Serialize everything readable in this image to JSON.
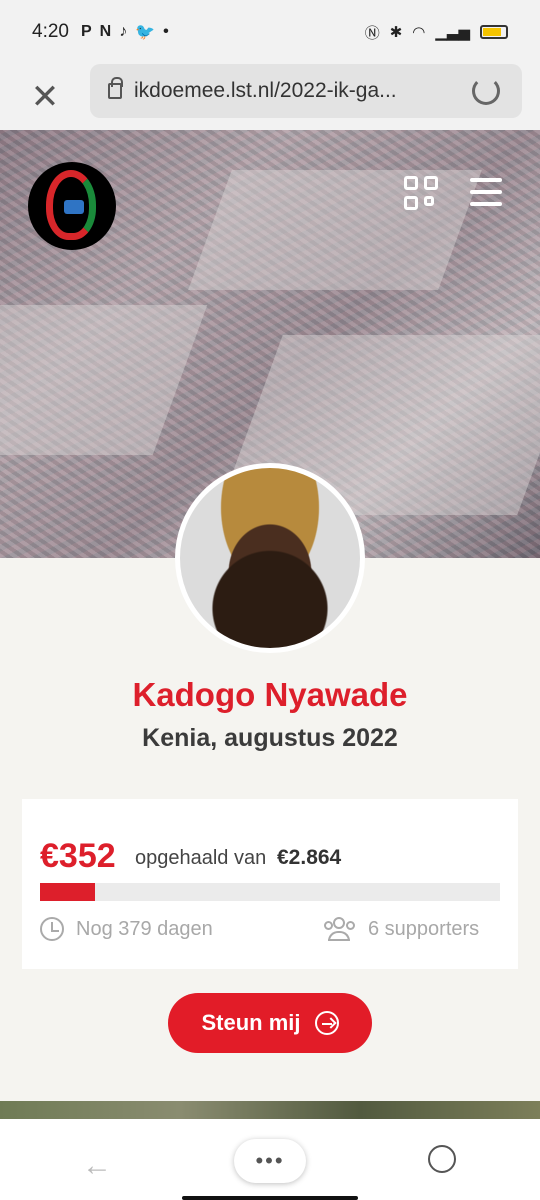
{
  "status_bar": {
    "time": "4:20",
    "apps": [
      "P",
      "N",
      "♪",
      "🐦",
      "•"
    ],
    "icons": [
      "nfc-icon",
      "bluetooth-icon",
      "wifi-icon",
      "signal-icon",
      "battery-icon"
    ]
  },
  "browser": {
    "url": "ikdoemee.lst.nl/2022-ik-ga...",
    "close_icon": "close-icon",
    "reload_icon": "reload-icon"
  },
  "hero": {
    "logo": "organization-logo",
    "qr_icon": "qr-code-icon",
    "menu_icon": "menu-icon"
  },
  "profile": {
    "name": "Kadogo Nyawade",
    "subtitle": "Kenia, augustus 2022"
  },
  "fundraising": {
    "amount": "€352",
    "raised_label": "opgehaald van",
    "goal": "€2.864",
    "progress": 0.12,
    "days_left": "Nog 379 dagen",
    "supporters": "6 supporters"
  },
  "cta": {
    "label": "Steun mij"
  },
  "bottom_nav": {
    "more_label": "•••"
  },
  "colors": {
    "accent": "#dd1f2b",
    "button": "#e21c28",
    "page_bg": "#f5f4f0"
  }
}
